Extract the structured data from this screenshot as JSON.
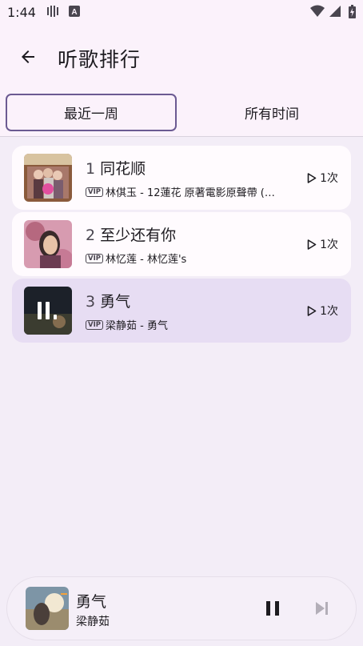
{
  "status_bar": {
    "time": "1:44"
  },
  "header": {
    "title": "听歌排行"
  },
  "tabs": [
    {
      "label": "最近一周",
      "active": true
    },
    {
      "label": "所有时间",
      "active": false
    }
  ],
  "songs": [
    {
      "rank": "1",
      "title": "同花顺",
      "vip": "VIP",
      "subtitle": "林倛玉 - 12蓮花 原著電影原聲帶 (…",
      "plays": "1次",
      "playing": false
    },
    {
      "rank": "2",
      "title": "至少还有你",
      "vip": "VIP",
      "subtitle": "林忆莲 - 林忆莲's",
      "plays": "1次",
      "playing": false
    },
    {
      "rank": "3",
      "title": "勇气",
      "vip": "VIP",
      "subtitle": "梁静茹 - 勇气",
      "plays": "1次",
      "playing": true
    }
  ],
  "now_playing": {
    "title": "勇气",
    "artist": "梁静茹"
  },
  "colors": {
    "accent": "#6b5a92",
    "playing_row": "#e7ddf3",
    "background": "#f3edf7"
  }
}
